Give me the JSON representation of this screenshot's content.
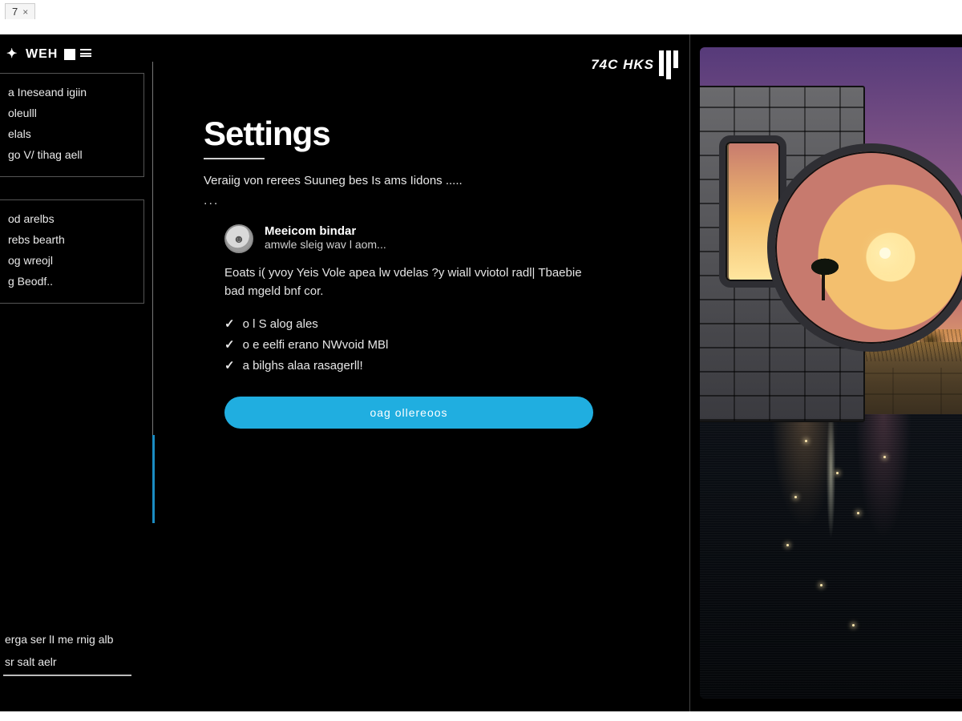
{
  "tab": {
    "label": "7",
    "close": "×"
  },
  "brand": {
    "text": "WEH"
  },
  "badge": {
    "text": "74C HKS"
  },
  "sidebar": {
    "group1": [
      "a Ineseand igiin",
      "oleulll",
      "elals",
      "go V/ tihag aell"
    ],
    "group2": [
      "od arelbs",
      "rebs bearth",
      "og wreojl",
      "g Beodf.."
    ],
    "footer": [
      "erga ser lI me rnig alb",
      "sr salt aelr"
    ]
  },
  "page": {
    "title": "Settings",
    "subtitle": "Veraiig von rerees Suuneg bes Is ams Iidons .....",
    "dots": "...",
    "card": {
      "title": "Meeicom bindar",
      "sub": "amwle sleig wav l aom..."
    },
    "desc": "Eoats i( yvoy Yeis Vole apea lw vdelas ?y wiall vviotol radl| Tbaebie bad mgeld bnf cor.",
    "checks": [
      "o l S alog ales",
      "o e eelfi erano NWvoid MBl",
      "a bilghs alaa rasagerll!"
    ],
    "cta": "oag ollereoos"
  }
}
